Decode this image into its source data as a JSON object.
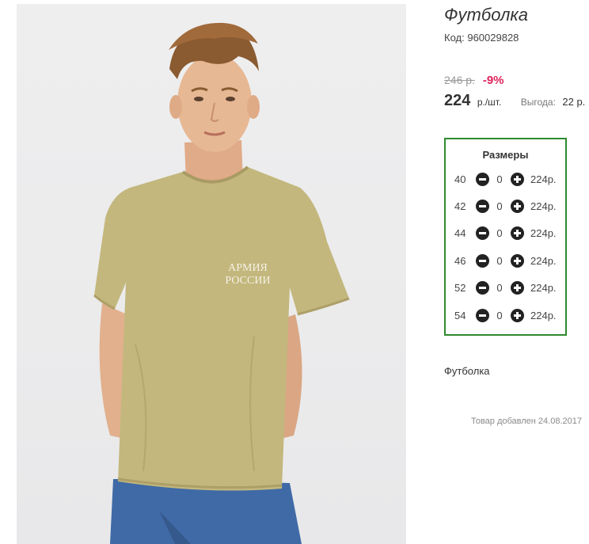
{
  "product": {
    "title": "Футболка",
    "code_label": "Код:",
    "code": "960029828",
    "old_price": "246 р.",
    "discount": "-9%",
    "price": "224",
    "price_unit": "р./шт.",
    "benefit_label": "Выгода:",
    "benefit": "22 р.",
    "description": "Футболка",
    "added": "Товар добавлен 24.08.2017"
  },
  "photo": {
    "shirt_print_line1": "АРМИЯ",
    "shirt_print_line2": "РОССИИ",
    "shirt_color": "#c3b77d",
    "background_color": "#ececed"
  },
  "sizes": {
    "title": "Размеры",
    "border_color": "#2f8a2f",
    "rows": [
      {
        "size": "40",
        "qty": "0",
        "price": "224р."
      },
      {
        "size": "42",
        "qty": "0",
        "price": "224р."
      },
      {
        "size": "44",
        "qty": "0",
        "price": "224р."
      },
      {
        "size": "46",
        "qty": "0",
        "price": "224р."
      },
      {
        "size": "52",
        "qty": "0",
        "price": "224р."
      },
      {
        "size": "54",
        "qty": "0",
        "price": "224р."
      }
    ]
  },
  "colors": {
    "discount": "#e0245e",
    "old_price": "#9a9a9a"
  }
}
